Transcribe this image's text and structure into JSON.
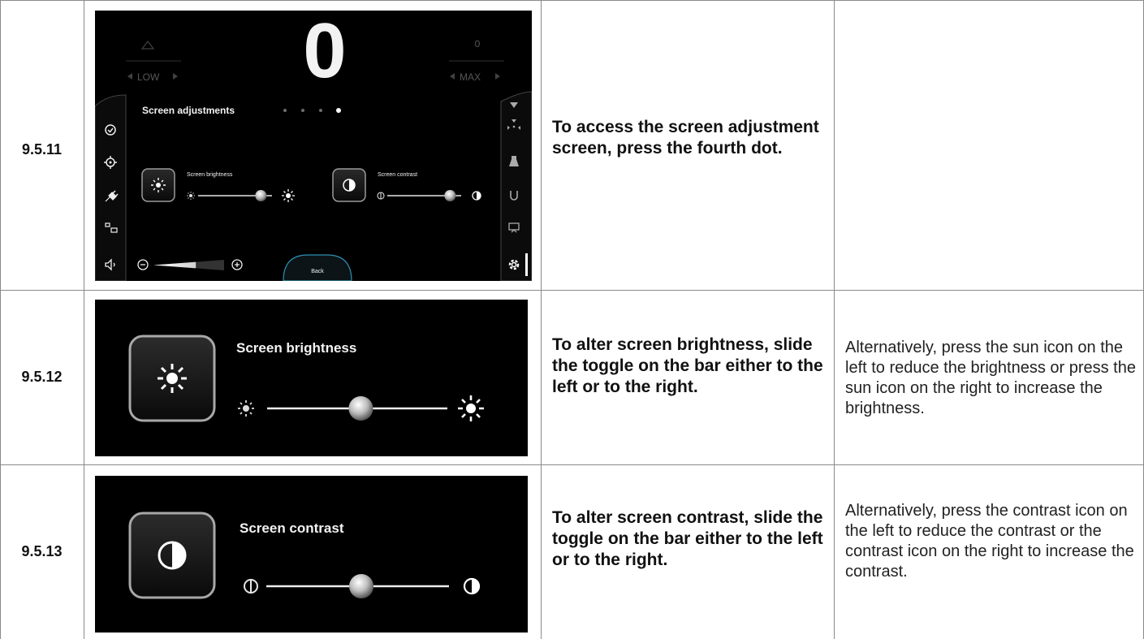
{
  "rows": [
    {
      "step": "9.5.11",
      "instruction": "To access the screen adjustment screen, press the fourth dot.",
      "note": "",
      "screen": {
        "left_indicator_label": "LOW",
        "center_value": "0",
        "right_value": "0",
        "right_indicator_label": "MAX",
        "panel_title": "Screen adjustments",
        "page_dots_total": 4,
        "page_dot_active": 4,
        "brightness_label": "Screen brightness",
        "brightness_level": 0.85,
        "contrast_label": "Screen contrast",
        "contrast_level": 0.85,
        "volume_level": 0.6,
        "back_label": "Back"
      }
    },
    {
      "step": "9.5.12",
      "instruction": "To alter screen brightness, slide the toggle on the bar either to the left or to the right.",
      "note": "Alternatively, press the sun icon on the left to reduce the brightness or press the sun icon on the right to increase the brightness.",
      "screen": {
        "label": "Screen brightness",
        "level": 0.52
      }
    },
    {
      "step": "9.5.13",
      "instruction": "To alter screen contrast, slide the toggle on the bar either to the left or to the right.",
      "note": "Alternatively, press the contrast icon on the left to reduce the contrast or the contrast icon on the right to increase the contrast.",
      "screen": {
        "label": "Screen contrast",
        "level": 0.52
      }
    }
  ]
}
